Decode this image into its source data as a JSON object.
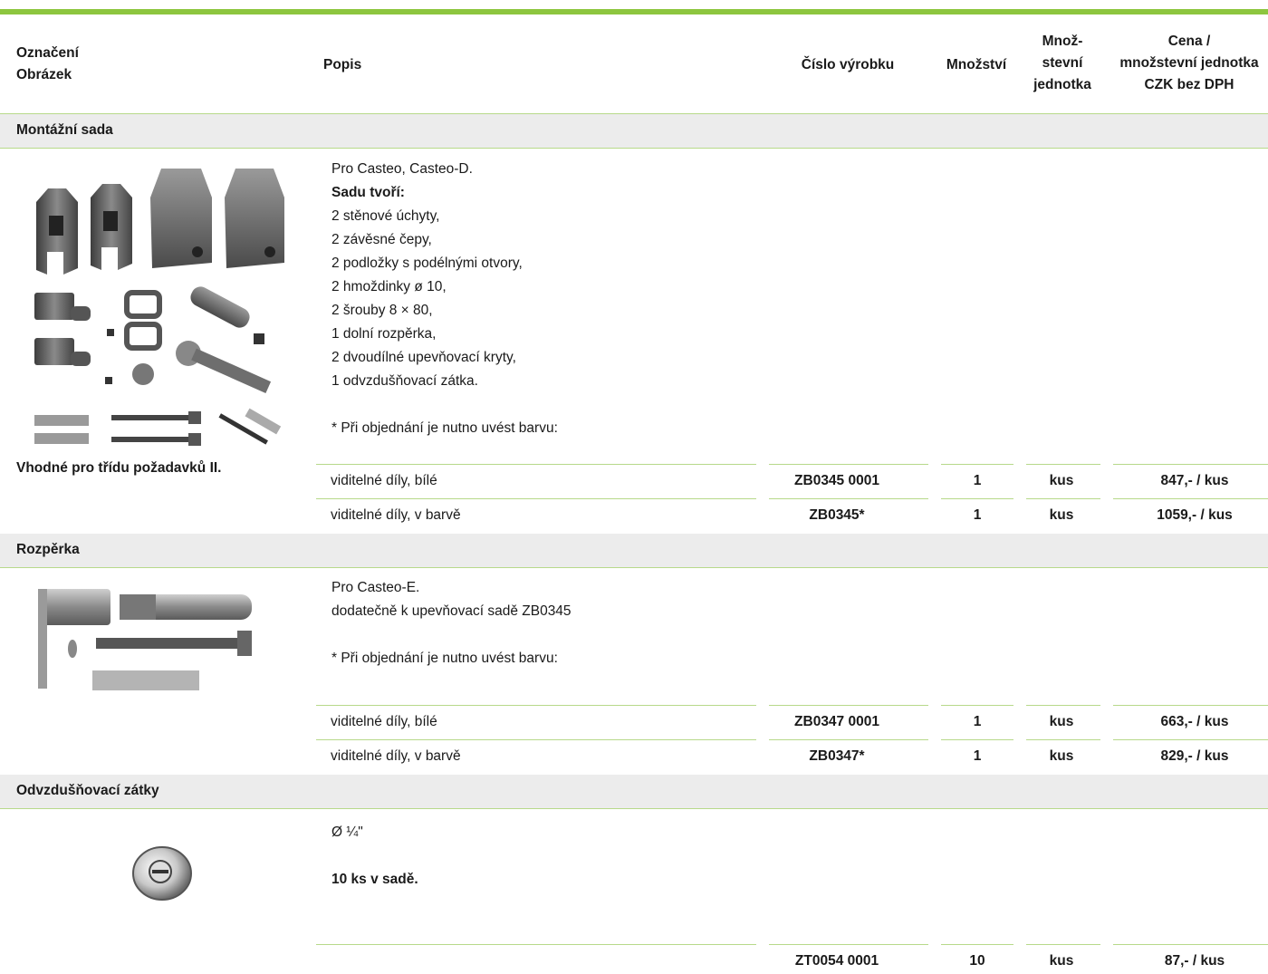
{
  "header": {
    "oznaceni_line1": "Označení",
    "oznaceni_line2": "Obrázek",
    "popis": "Popis",
    "cislo": "Číslo výrobku",
    "mnozstvi": "Množství",
    "jednotka_line1": "Množ-",
    "jednotka_line2": "stevní",
    "jednotka_line3": "jednotka",
    "cena_line1": "Cena /",
    "cena_line2": "množstevní jednotka",
    "cena_line3": "CZK bez DPH"
  },
  "sections": [
    {
      "title": "Montážní sada",
      "desc": [
        "Pro Casteo, Casteo-D."
      ],
      "desc_bold": "Sadu tvoří:",
      "items": [
        "2 stěnové úchyty,",
        "2 závěsné čepy,",
        "2 podložky s podélnými otvory,",
        "2 hmoždinky ø 10,",
        "2 šrouby 8 × 80,",
        "1 dolní rozpěrka,",
        "2 dvoudílné upevňovací kryty,",
        "1 odvzdušňovací zátka."
      ],
      "note": "* Při objednání je nutno uvést barvu:",
      "caption": "Vhodné pro třídu požadavků II.",
      "rows": [
        {
          "variant": "viditelné díly, bílé",
          "code": "ZB0345 0001",
          "qty": "1",
          "unit": "kus",
          "price": "847,- / kus"
        },
        {
          "variant": "viditelné díly, v barvě",
          "code": "ZB0345*",
          "qty": "1",
          "unit": "kus",
          "price": "1059,- / kus"
        }
      ]
    },
    {
      "title": "Rozpěrka",
      "desc": [
        "Pro Casteo-E.",
        "dodatečně k upevňovací sadě ZB0345"
      ],
      "note": "* Při objednání je nutno uvést barvu:",
      "rows": [
        {
          "variant": "viditelné díly, bílé",
          "code": "ZB0347 0001",
          "qty": "1",
          "unit": "kus",
          "price": "663,- / kus"
        },
        {
          "variant": "viditelné díly, v barvě",
          "code": "ZB0347*",
          "qty": "1",
          "unit": "kus",
          "price": "829,- / kus"
        }
      ]
    },
    {
      "title": "Odvzdušňovací zátky",
      "desc": [
        "Ø ¼\""
      ],
      "desc_bold": "10 ks v sadě.",
      "rows": [
        {
          "variant": "",
          "code": "ZT0054 0001",
          "qty": "10",
          "unit": "kus",
          "price": "87,- / kus"
        }
      ]
    }
  ],
  "colors": {
    "accent": "#8dc63f",
    "rule": "#b7d98a",
    "section_bg": "#ececec"
  }
}
